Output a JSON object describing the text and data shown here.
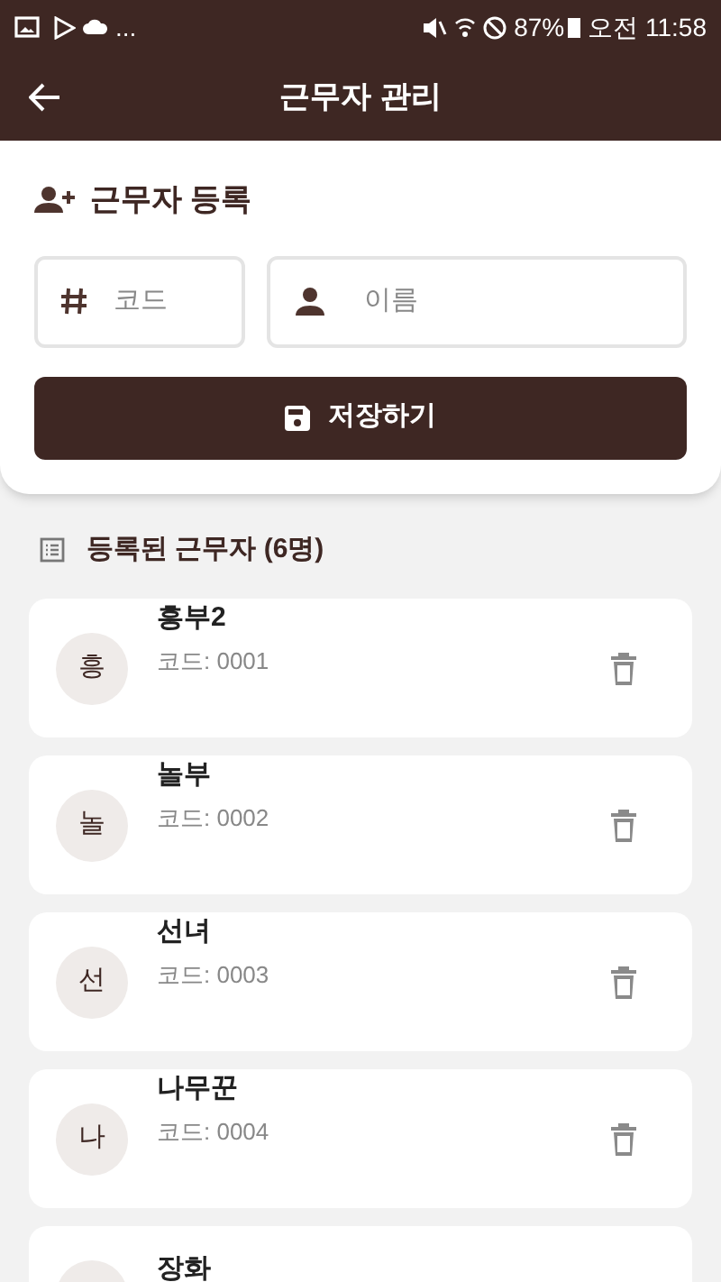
{
  "status_bar": {
    "dots": "...",
    "battery": "87%",
    "time": "오전 11:58"
  },
  "header": {
    "title": "근무자 관리"
  },
  "register": {
    "title": "근무자 등록",
    "code_field": {
      "placeholder": "코드"
    },
    "name_field": {
      "placeholder": "이름"
    },
    "save_button": "저장하기"
  },
  "list": {
    "title": "등록된 근무자 (6명)",
    "workers": [
      {
        "initial": "흥",
        "name": "흥부2",
        "code": "코드: 0001"
      },
      {
        "initial": "놀",
        "name": "놀부",
        "code": "코드: 0002"
      },
      {
        "initial": "선",
        "name": "선녀",
        "code": "코드: 0003"
      },
      {
        "initial": "나",
        "name": "나무꾼",
        "code": "코드: 0004"
      },
      {
        "name": "장화"
      }
    ]
  }
}
